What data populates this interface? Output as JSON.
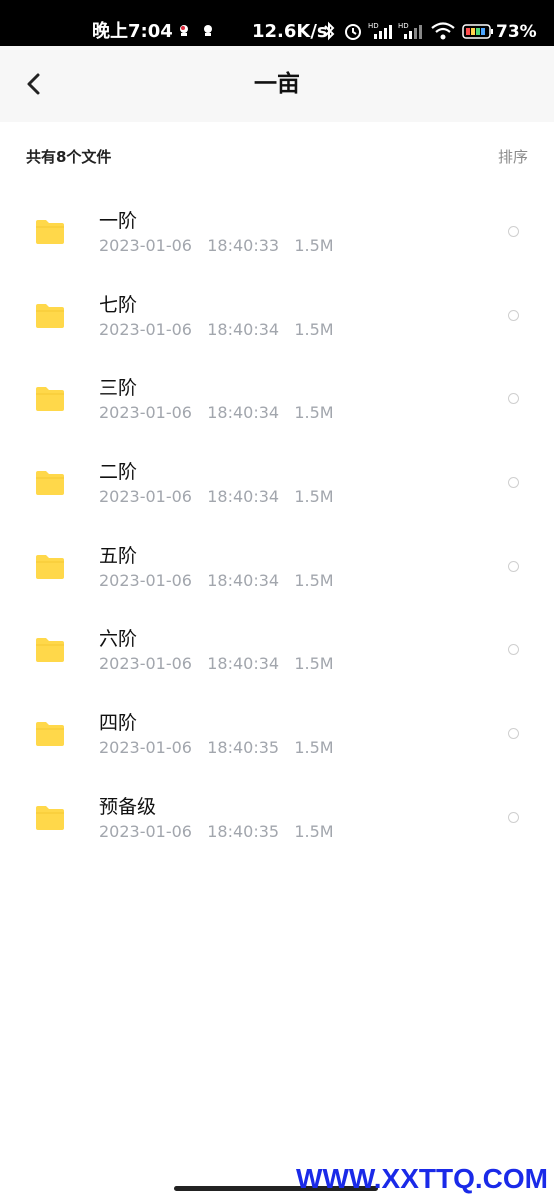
{
  "status_bar": {
    "time": "晚上7:04",
    "network_speed": "12.6K/s",
    "battery_percent": "73%",
    "icons": [
      "notification-app-icon",
      "notification-app-icon",
      "bluetooth-icon",
      "alarm-icon",
      "signal-hd-icon",
      "signal-hd-icon",
      "wifi-icon",
      "battery-icon"
    ]
  },
  "header": {
    "title": "一亩",
    "back_icon": "chevron-left-icon"
  },
  "summary": {
    "count_label": "共有8个文件",
    "sort_label": "排序"
  },
  "files": [
    {
      "name": "一阶",
      "meta": "2023-01-06   18:40:33   1.5M"
    },
    {
      "name": "七阶",
      "meta": "2023-01-06   18:40:34   1.5M"
    },
    {
      "name": "三阶",
      "meta": "2023-01-06   18:40:34   1.5M"
    },
    {
      "name": "二阶",
      "meta": "2023-01-06   18:40:34   1.5M"
    },
    {
      "name": "五阶",
      "meta": "2023-01-06   18:40:34   1.5M"
    },
    {
      "name": "六阶",
      "meta": "2023-01-06   18:40:34   1.5M"
    },
    {
      "name": "四阶",
      "meta": "2023-01-06   18:40:35   1.5M"
    },
    {
      "name": "预备级",
      "meta": "2023-01-06   18:40:35   1.5M"
    }
  ],
  "watermark": "WWW.XXTTQ.COM",
  "colors": {
    "folder": "#ffd84a",
    "meta_text": "#a2a6ad",
    "watermark": "#1a2ae8"
  }
}
